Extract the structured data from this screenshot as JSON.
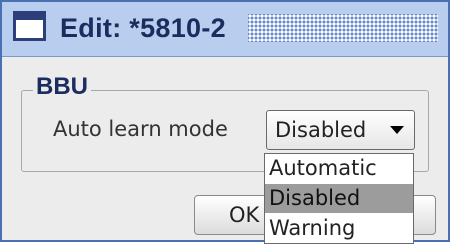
{
  "window": {
    "title": "Edit: *5810-2"
  },
  "group": {
    "label": "BBU"
  },
  "field": {
    "label": "Auto learn mode",
    "selected_value": "Disabled"
  },
  "dropdown": {
    "options": [
      "Automatic",
      "Disabled",
      "Warning"
    ],
    "highlighted": "Disabled"
  },
  "buttons": {
    "ok_label": "OK"
  },
  "colors": {
    "titlebar": "#b9cdee",
    "title_text": "#1b2c5e",
    "window_border": "#4a6fb3",
    "highlight": "#9c9c9c",
    "background": "#ececec"
  },
  "icons": {
    "title": "window-icon",
    "combo_arrow": "chevron-down-icon"
  }
}
